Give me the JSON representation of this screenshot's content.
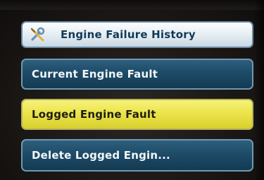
{
  "menu": {
    "title": "Engine Failure History",
    "title_icon": "wrench-screwdriver-icon",
    "items": [
      {
        "label": "Current Engine Fault",
        "selected": false
      },
      {
        "label": "Logged Engine Fault",
        "selected": true
      },
      {
        "label": "Delete Logged Engin..."
      }
    ]
  },
  "colors": {
    "title_bg": "#e4ecf2",
    "title_text": "#123a58",
    "item_bg": "#1d4b68",
    "item_border": "#6f99b5",
    "item_text": "#f2f6f9",
    "selected_bg": "#ece44c",
    "selected_text": "#1e1e10"
  }
}
